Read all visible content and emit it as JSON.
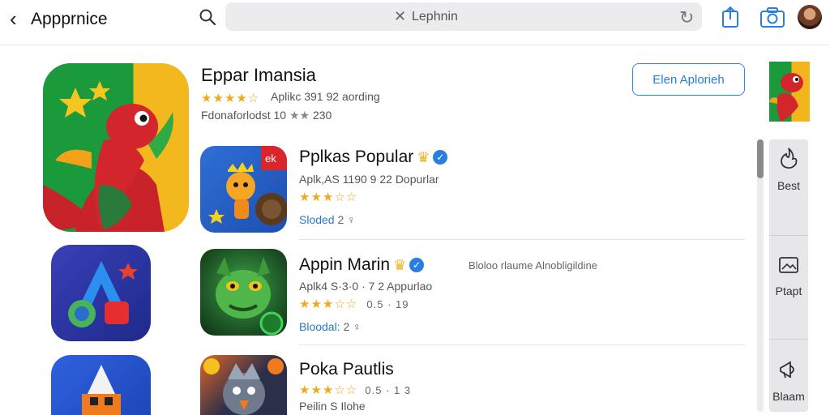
{
  "header": {
    "back_label": "Appprnice",
    "search_value": "Lephnin"
  },
  "featured": {
    "title": "Eppar Imansia",
    "rating_stars": "★★★★☆",
    "subtitle_1": "Aplikc 391 92 aording",
    "subtitle_2_prefix": "Fdonaforlodst 10",
    "subtitle_2_stars": "★★",
    "subtitle_2_suffix": "230",
    "get_button_label": "Elen Aplorieh"
  },
  "list": [
    {
      "title": "Pplkas Popular",
      "subtitle": "Aplk,AS 1190 9 22 Dopurlar",
      "stars": "★★★☆☆",
      "extra": "",
      "link_label": "Sloded",
      "link_meta": "2  ♀"
    },
    {
      "title": "Appin Marin",
      "subtitle": "Aplk4 S·3·0 · 7 2 Appurlao",
      "stars": "★★★☆☆",
      "extra": "0.5 · 19",
      "link_label": "Bloodal:",
      "link_meta": "2  ♀"
    },
    {
      "title": "Poka Pautlis",
      "subtitle": "",
      "stars": "★★★☆☆",
      "extra": "0.5 · 1 3",
      "link_label": "Peilin S Ilohe",
      "link_meta": ""
    }
  ],
  "description_text": "Bloloo rlaume Alnobligildine",
  "side_panel": {
    "items": [
      {
        "label": "Best"
      },
      {
        "label": "Ptapt"
      },
      {
        "label": "Blaam"
      }
    ]
  },
  "colors": {
    "accent": "#2f8be0",
    "star": "#f1a91b",
    "badge": "#2a7de1"
  },
  "icons": [
    "back-icon",
    "search-icon",
    "clear-icon",
    "refresh-icon",
    "share-icon",
    "camera-icon",
    "verified-badge-icon",
    "crown-icon"
  ]
}
